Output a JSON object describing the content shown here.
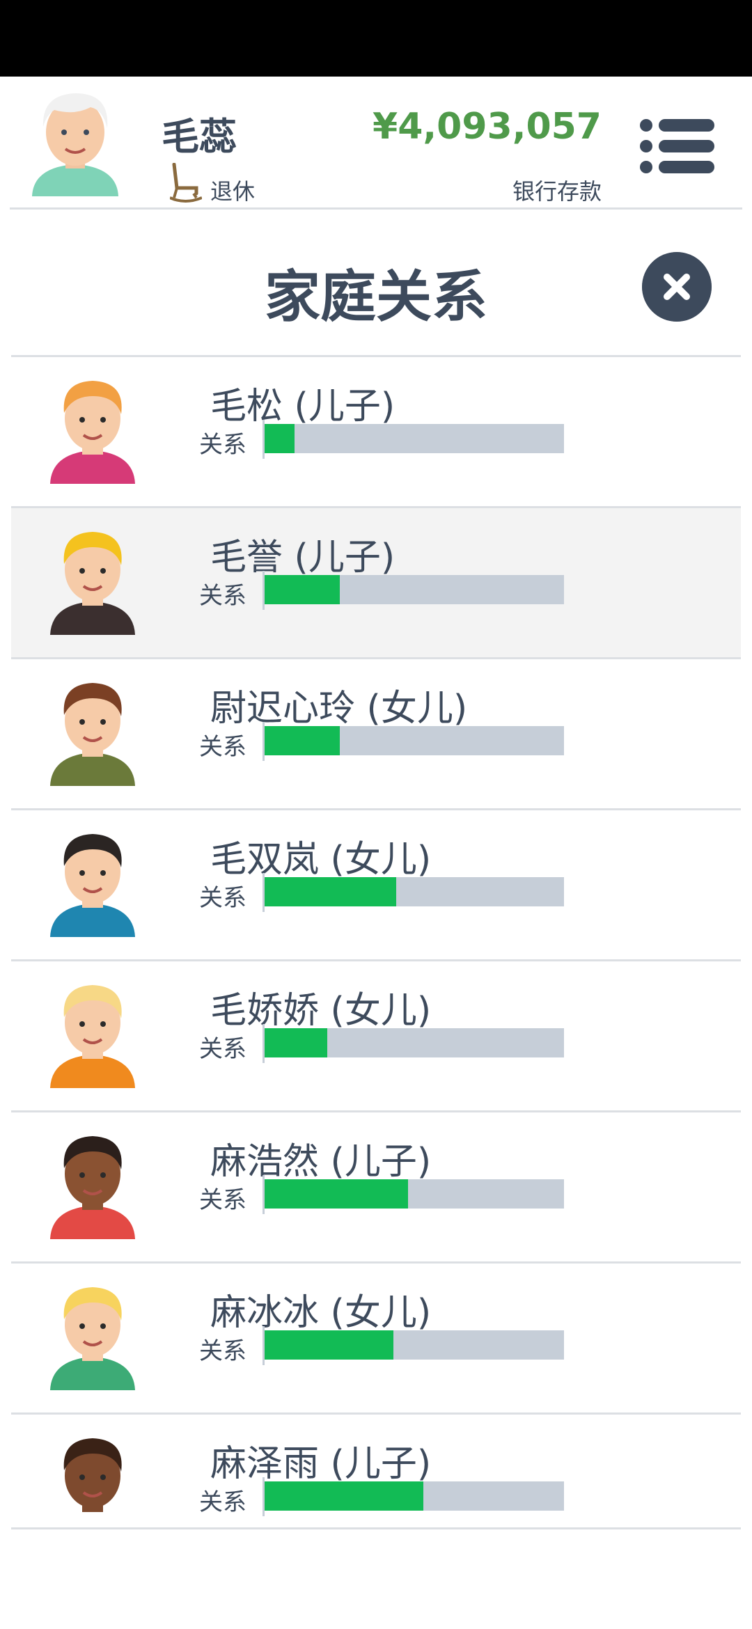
{
  "player": {
    "name": "毛蕊",
    "status": "退休",
    "money": "¥4,093,057",
    "money_label": "银行存款"
  },
  "panel": {
    "title": "家庭关系"
  },
  "relation_label": "关系",
  "members": [
    {
      "name": "毛松 (儿子)",
      "relation": 0.1,
      "avatar": "boy-ginger-pink-shirt"
    },
    {
      "name": "毛誉 (儿子)",
      "relation": 0.25,
      "avatar": "man-blond-beard-jacket"
    },
    {
      "name": "尉迟心玲 (女儿)",
      "relation": 0.25,
      "avatar": "woman-brown-bob-olive"
    },
    {
      "name": "毛双岚 (女儿)",
      "relation": 0.44,
      "avatar": "woman-black-hair-blue"
    },
    {
      "name": "毛娇娇 (女儿)",
      "relation": 0.21,
      "avatar": "woman-blonde-orange"
    },
    {
      "name": "麻浩然 (儿子)",
      "relation": 0.48,
      "avatar": "man-dark-beard-red"
    },
    {
      "name": "麻冰冰 (女儿)",
      "relation": 0.43,
      "avatar": "woman-blonde-green"
    },
    {
      "name": "麻泽雨 (儿子)",
      "relation": 0.53,
      "avatar": "man-curly-beard"
    }
  ],
  "colors": {
    "bar_fill": "#12bb55",
    "bar_track": "#c6ced8",
    "money": "#4f9a4a",
    "text": "#3d4a5c"
  }
}
